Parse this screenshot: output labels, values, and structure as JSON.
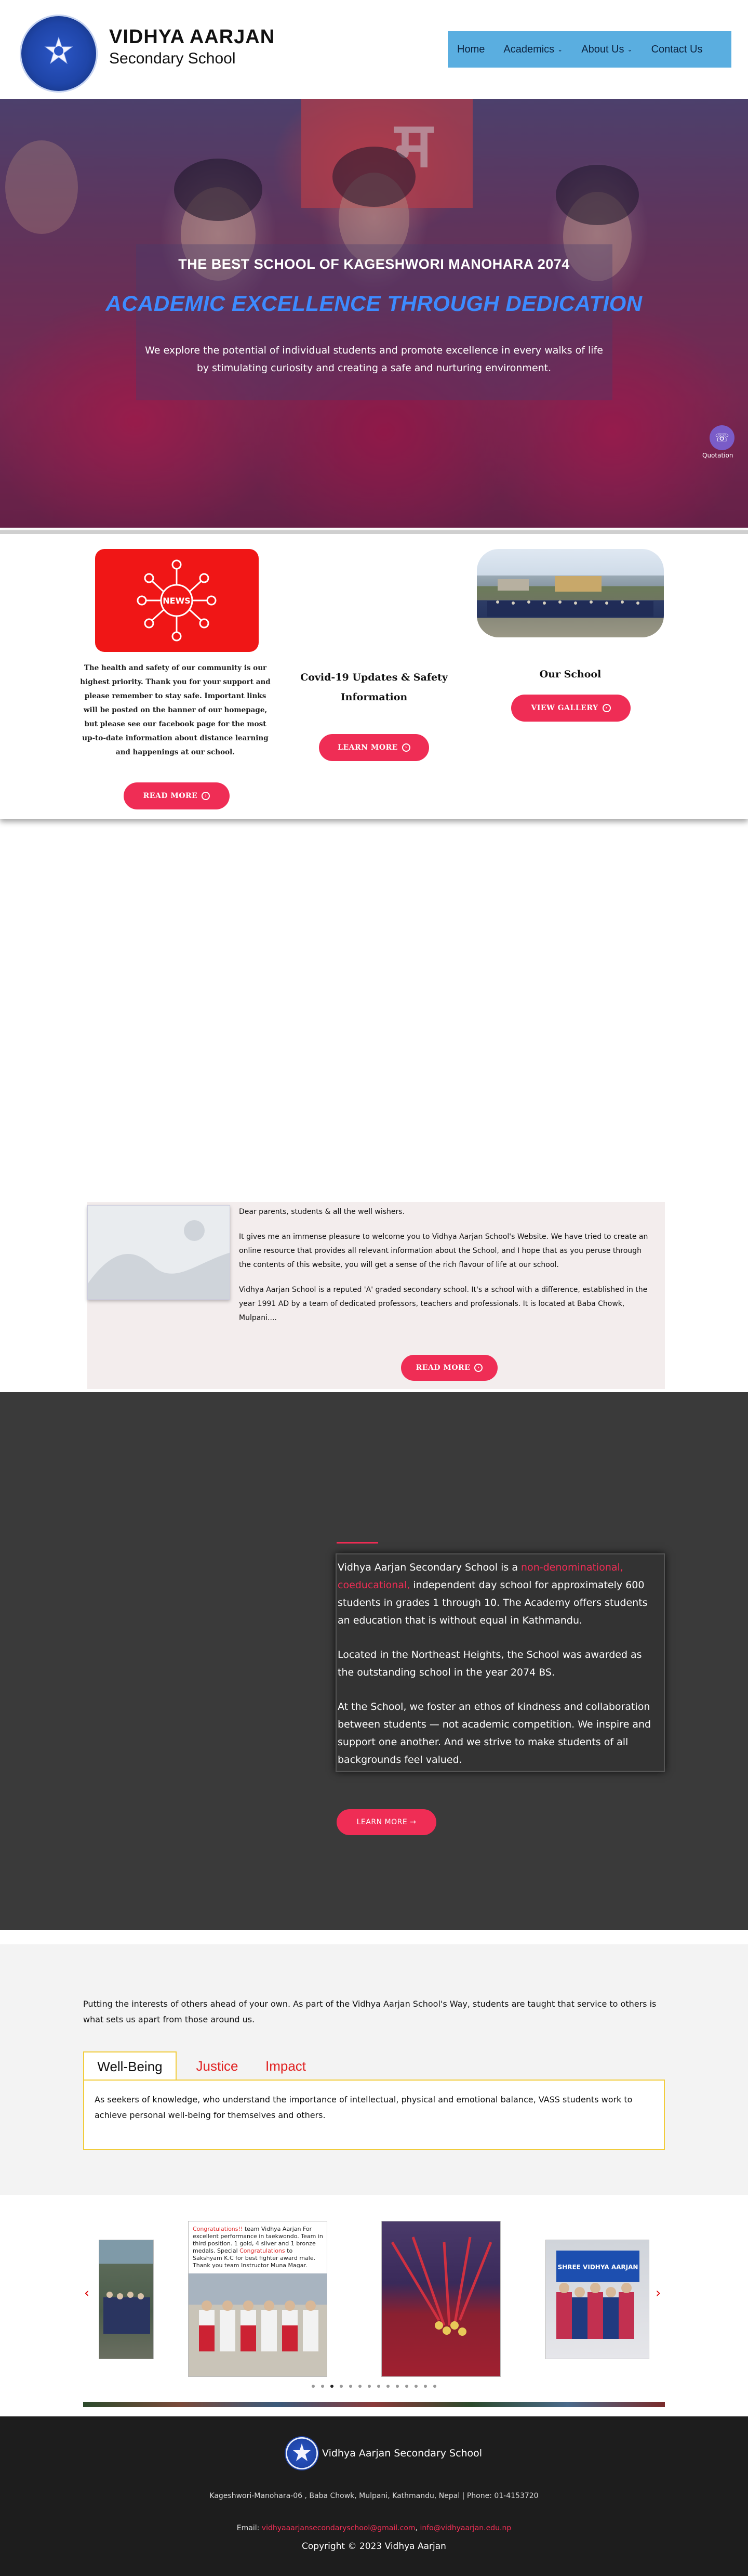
{
  "header": {
    "brand_name": "VIDHYA AARJAN",
    "brand_sub": "Secondary School",
    "nav": [
      {
        "label": "Home"
      },
      {
        "label": "Academics"
      },
      {
        "label": "About Us"
      },
      {
        "label": "Contact Us"
      }
    ]
  },
  "hero": {
    "kicker": "THE BEST SCHOOL OF KAGESHWORI MANOHARA 2074",
    "title": "ACADEMIC EXCELLENCE THROUGH DEDICATION",
    "description": "We explore the potential of individual students and promote excellence in every walks of life by stimulating curiosity and creating a safe and nurturing environment.",
    "phone_label": "Quotation",
    "banner_letter": "म"
  },
  "cards": {
    "news_label": "NEWS",
    "card1_text": "The health and safety of our community is our highest priority. Thank you for your support and please remember to stay safe. Important links will be posted on the banner of our homepage, but please see our facebook page for the most up-to-date information about distance learning and happenings at our school.",
    "card1_button": "READ MORE",
    "card2_title": "Covid-19 Updates & Safety Information",
    "card2_button": "LEARN MORE",
    "card3_title": "Our School",
    "card3_button": "VIEW GALLERY"
  },
  "welcome": {
    "greeting": "Dear parents, students & all the well wishers.",
    "para1": "It gives me an immense pleasure to welcome you to Vidhya Aarjan School's Website. We have tried to create an online resource that provides all relevant information about the School, and I hope that as you peruse through the contents of this website, you will get a sense of the rich flavour of life at our school.",
    "para2": "Vidhya Aarjan School is a reputed 'A' graded secondary school. It's a school with a difference, established in the year 1991 AD by a team of dedicated professors, teachers and professionals. It is located at Baba Chowk, Mulpani....",
    "button": "READ MORE"
  },
  "about": {
    "p1_prefix": "Vidhya Aarjan Secondary School is a ",
    "p1_highlight1": "non-denominational,",
    "p1_highlight2": "coeducational,",
    "p1_suffix": " independent day school for approximately 600 students in grades 1 through 10. The Academy offers students an education that is without equal in Kathmandu.",
    "p2": "Located in the Northeast Heights, the School was awarded as the outstanding school in the year 2074 BS.",
    "p3": "At the School, we foster an ethos of kindness and collaboration between students — not academic competition. We inspire and support one another. And we strive to make students of all backgrounds feel valued.",
    "button": "LEARN MORE →"
  },
  "values": {
    "intro": "Putting the interests of others ahead of your own. As part of the Vidhya Aarjan School's Way, students are taught that service to others is what sets us apart from those around us.",
    "tabs": [
      {
        "label": "Well-Being"
      },
      {
        "label": "Justice"
      },
      {
        "label": "Impact"
      }
    ],
    "active_text": "As seekers of knowledge, who understand the importance of intellectual, physical and emotional balance, VASS students work to achieve personal well-being for themselves and others."
  },
  "gallery": {
    "prev": "‹",
    "next": "›",
    "slide2_caption_highlight": "Congratulations!!",
    "slide2_caption": " team Vidhya Aarjan For excellent performance in taekwondo. Team in third position. 1 gold, 4 silver and 1 bronze medals. Special ",
    "slide2_caption_highlight2": "Congratulations",
    "slide2_caption_end": " to Sakshyam K.C for best fighter award male. Thank you team Instructor Muna Magar.",
    "slide4_banner": "SHREE VIDHYA AARJAN",
    "dot_count": 14,
    "active_dot": 2
  },
  "footer": {
    "name": "Vidhya Aarjan Secondary School",
    "address": "Kageshwori-Manohara-06 , Baba Chowk, Mulpani, Kathmandu, Nepal | Phone: 01-4153720",
    "email_label": "Email: ",
    "email1": "vidhyaaarjansecondaryschool@gmail.com",
    "email_sep": ", ",
    "email2": "info@vidhyaarjan.edu.np",
    "copyright": "Copyright © 2023 Vidhya Aarjan"
  },
  "colors": {
    "accent": "#ef2d55",
    "nav_bg": "#5aaee0",
    "hero_title": "#3d8bff",
    "dark_bg": "#3a3a3a",
    "tab_border": "#f1cc3c",
    "footer_bg": "#1d1d1d"
  },
  "icons": {
    "phone": "phone-icon",
    "arrow_circle": "arrow-circle-icon",
    "chevron": "chevron-down-icon"
  }
}
